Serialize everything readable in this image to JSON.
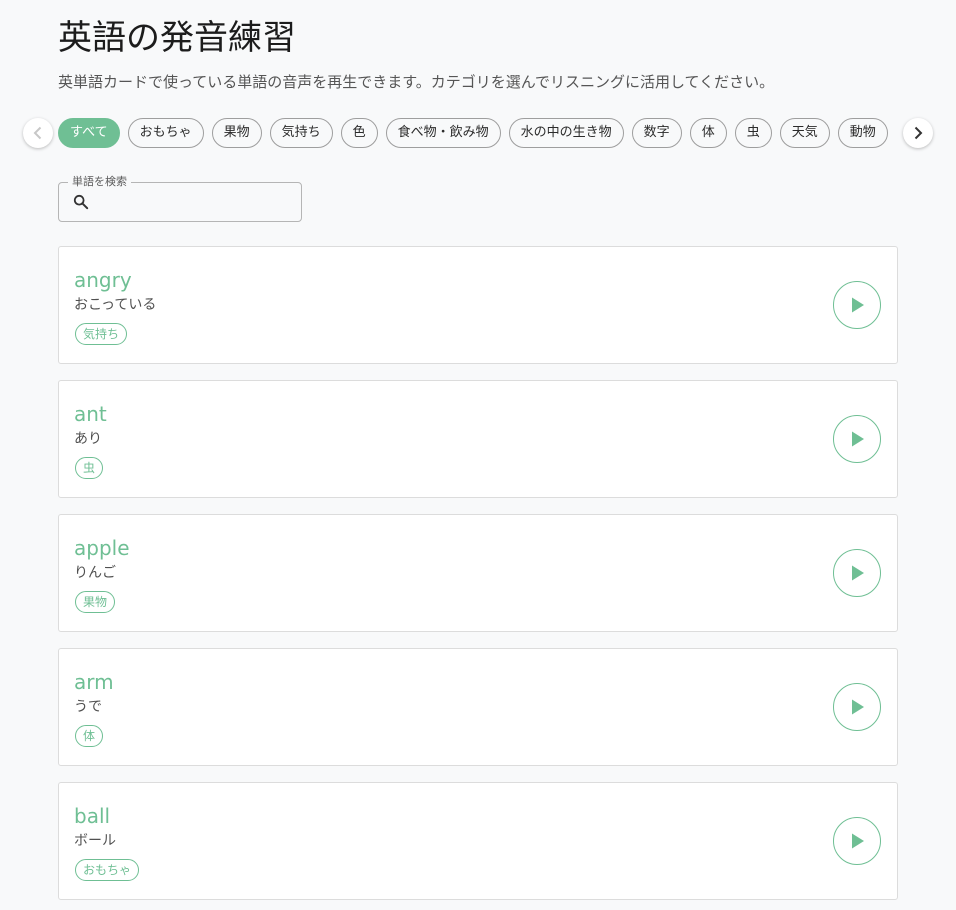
{
  "page": {
    "title": "英語の発音練習",
    "subtitle": "英単語カードで使っている単語の音声を再生できます。カテゴリを選んでリスニングに活用してください。"
  },
  "categories": [
    {
      "label": "すべて",
      "active": true
    },
    {
      "label": "おもちゃ",
      "active": false
    },
    {
      "label": "果物",
      "active": false
    },
    {
      "label": "気持ち",
      "active": false
    },
    {
      "label": "色",
      "active": false
    },
    {
      "label": "食べ物・飲み物",
      "active": false
    },
    {
      "label": "水の中の生き物",
      "active": false
    },
    {
      "label": "数字",
      "active": false
    },
    {
      "label": "体",
      "active": false
    },
    {
      "label": "虫",
      "active": false
    },
    {
      "label": "天気",
      "active": false
    },
    {
      "label": "動物",
      "active": false
    }
  ],
  "search": {
    "label": "単語を検索",
    "value": "",
    "placeholder": ""
  },
  "words": [
    {
      "word": "angry",
      "meaning": "おこっている",
      "category": "気持ち"
    },
    {
      "word": "ant",
      "meaning": "あり",
      "category": "虫"
    },
    {
      "word": "apple",
      "meaning": "りんご",
      "category": "果物"
    },
    {
      "word": "arm",
      "meaning": "うで",
      "category": "体"
    },
    {
      "word": "ball",
      "meaning": "ボール",
      "category": "おもちゃ"
    }
  ],
  "icons": {
    "scroll_left": "chevron-left-icon",
    "scroll_right": "chevron-right-icon",
    "search": "search-icon",
    "play": "play-icon"
  },
  "colors": {
    "accent": "#6fbf94",
    "background": "#f8f9fa",
    "card": "#ffffff",
    "chevron_disabled": "#c7c7c7",
    "chevron_enabled": "#333333"
  }
}
